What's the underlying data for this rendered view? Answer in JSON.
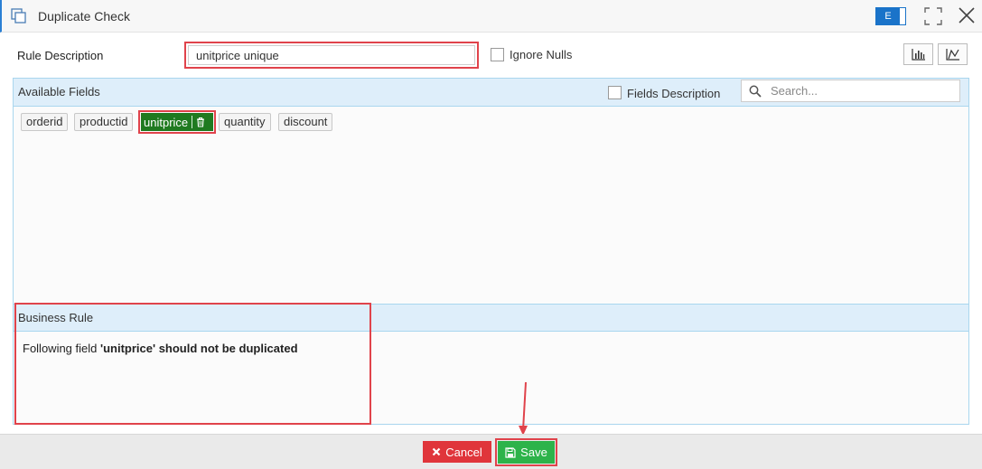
{
  "window": {
    "title": "Duplicate Check",
    "language_toggle": "E",
    "accent_color": "#1a73c9"
  },
  "rule": {
    "label": "Rule Description",
    "value": "unitprice unique",
    "ignore_nulls_label": "Ignore Nulls"
  },
  "available_fields": {
    "title": "Available Fields",
    "fields_description_label": "Fields Description",
    "search_placeholder": "Search...",
    "fields": [
      "orderid",
      "productid",
      "unitprice",
      "quantity",
      "discount"
    ],
    "selected_field": "unitprice",
    "selected_color": "#1f7a20"
  },
  "business_rule": {
    "title": "Business Rule",
    "text_prefix": "Following field ",
    "text_bold": "'unitprice' should not be duplicated"
  },
  "footer": {
    "cancel_label": "Cancel",
    "save_label": "Save",
    "cancel_color": "#e0353b",
    "save_color": "#2db34a"
  },
  "annotation_color": "#e0434b"
}
